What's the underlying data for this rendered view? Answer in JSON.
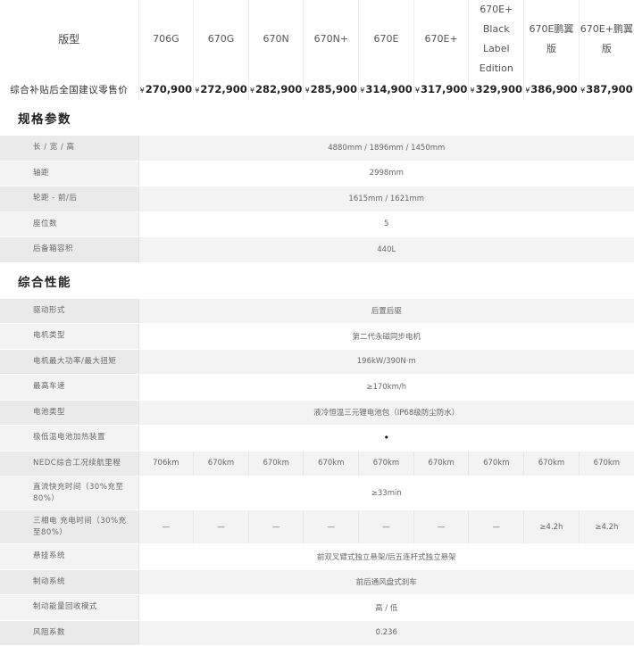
{
  "header": {
    "label": "版型",
    "versions": [
      "706G",
      "670G",
      "670N",
      "670N+",
      "670E",
      "670E+",
      "670E+ Black Label Edition",
      "670E鹏翼版",
      "670E+鹏翼版"
    ]
  },
  "price": {
    "label": "综合补贴后全国建议零售价",
    "currency": "¥",
    "values": [
      "270,900",
      "272,900",
      "282,900",
      "285,900",
      "314,900",
      "317,900",
      "329,900",
      "386,900",
      "387,900"
    ]
  },
  "spec": {
    "title": "规格参数",
    "rows": [
      {
        "label": "长 / 宽 / 高",
        "value": "4880mm / 1896mm / 1450mm"
      },
      {
        "label": "轴距",
        "value": "2998mm"
      },
      {
        "label": "轮距 - 前/后",
        "value": "1615mm / 1621mm"
      },
      {
        "label": "座位数",
        "value": "5"
      },
      {
        "label": "后备箱容积",
        "value": "440L"
      }
    ]
  },
  "perf": {
    "title": "综合性能",
    "rows": [
      {
        "label": "驱动形式",
        "value": "后置后驱"
      },
      {
        "label": "电机类型",
        "value": "第二代永磁同步电机"
      },
      {
        "label": "电机最大功率/最大扭矩",
        "value": "196kW/390N·m"
      },
      {
        "label": "最高车速",
        "value": "≥170km/h"
      },
      {
        "label": "电池类型",
        "value": "液冷恒温三元锂电池包（IP68级防尘防水）"
      },
      {
        "label": "极低温电池加热装置",
        "value": "•"
      }
    ],
    "nedc": {
      "label": "NEDC综合工况续航里程",
      "values": [
        "706km",
        "670km",
        "670km",
        "670km",
        "670km",
        "670km",
        "670km",
        "670km",
        "670km"
      ]
    },
    "dc_charge": {
      "label": "直流快充时间（30%充至80%）",
      "value": "≥33min"
    },
    "ac_charge": {
      "label": "三相电 充电时间（30%充至80%）",
      "values": [
        "—",
        "—",
        "—",
        "—",
        "—",
        "—",
        "—",
        "≥4.2h",
        "≥4.2h"
      ]
    },
    "rows2": [
      {
        "label": "悬挂系统",
        "value": "前双叉臂式独立悬架/后五连杆式独立悬架"
      },
      {
        "label": "制动系统",
        "value": "前后通风盘式刹车"
      },
      {
        "label": "制动能量回收模式",
        "value": "高 / 低"
      },
      {
        "label": "风阻系数",
        "value": "0.236"
      }
    ]
  }
}
